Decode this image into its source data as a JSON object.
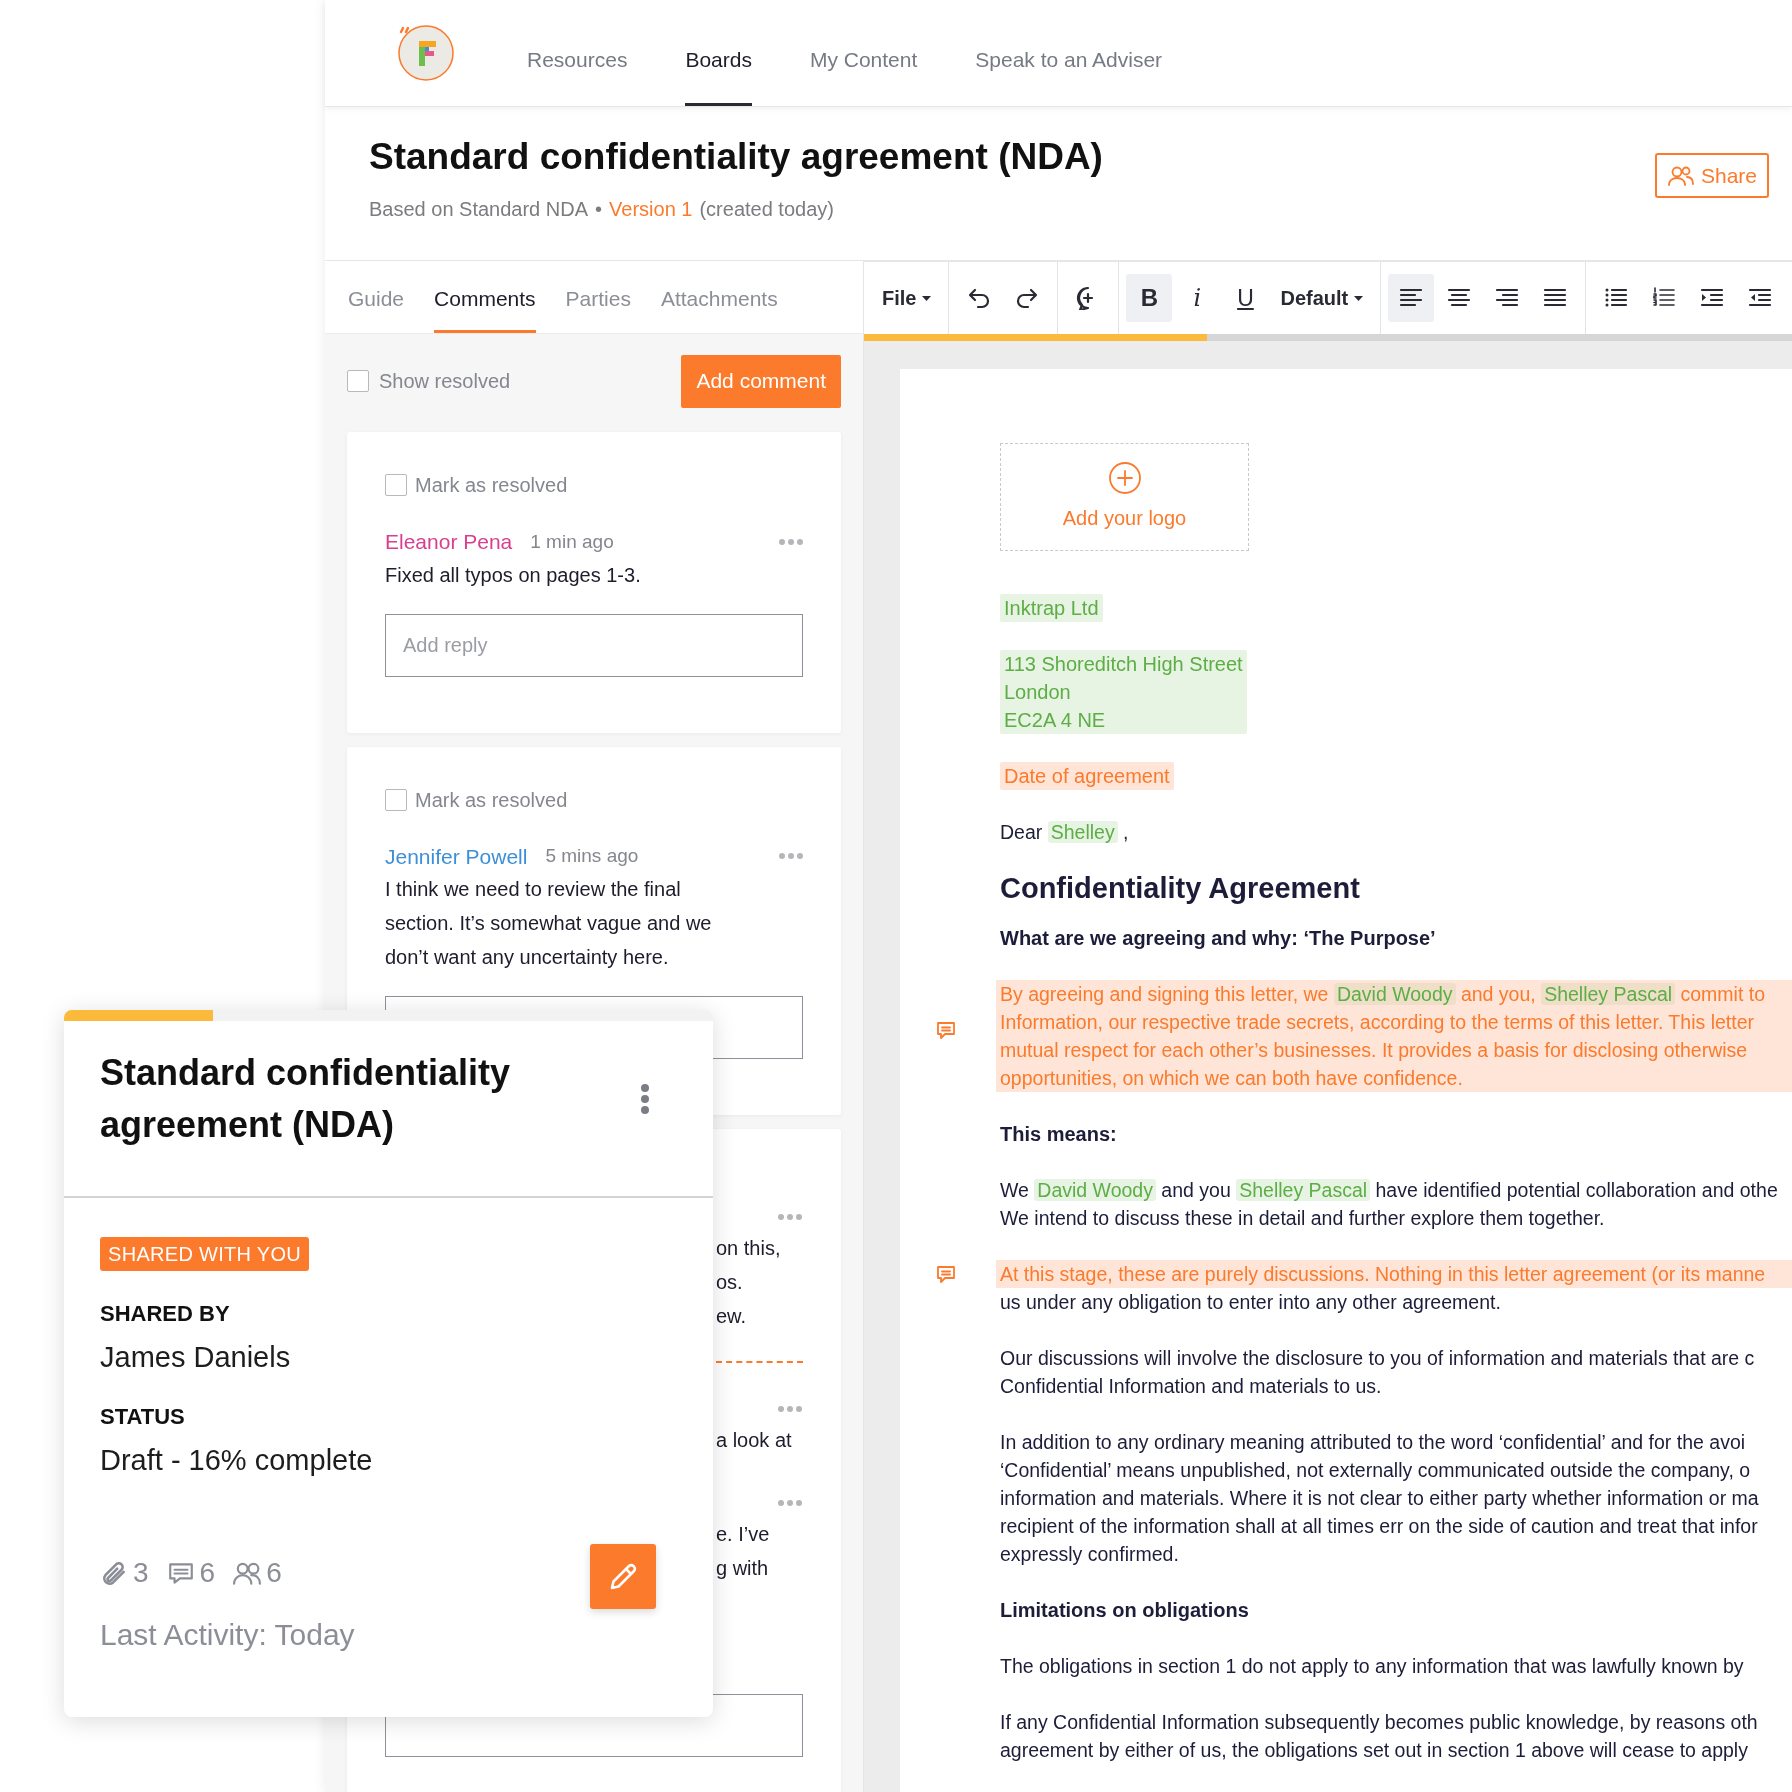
{
  "nav": {
    "items": [
      {
        "label": "Resources",
        "selected": false
      },
      {
        "label": "Boards",
        "selected": true
      },
      {
        "label": "My Content",
        "selected": false
      },
      {
        "label": "Speak to an Adviser",
        "selected": false
      }
    ]
  },
  "header": {
    "title": "Standard confidentiality agreement (NDA)",
    "based_on": "Based on Standard NDA",
    "separator": "•",
    "version": "Version 1",
    "created": "(created today)",
    "share": "Share"
  },
  "panel_tabs": [
    {
      "label": "Guide",
      "selected": false
    },
    {
      "label": "Comments",
      "selected": true
    },
    {
      "label": "Parties",
      "selected": false
    },
    {
      "label": "Attachments",
      "selected": false
    }
  ],
  "comments_panel": {
    "show_resolved": {
      "label": "Show resolved",
      "checked": false
    },
    "add_button": "Add comment",
    "comments": [
      {
        "kind": "full",
        "resolve": {
          "label": "Mark as resolved",
          "checked": false
        },
        "author": "Eleanor Pena",
        "color": "#d8408f",
        "time": "1 min ago",
        "text": "Fixed all typos on pages 1-3.",
        "reply_placeholder": "Add reply"
      },
      {
        "kind": "full",
        "resolve": {
          "label": "Mark as resolved",
          "checked": false
        },
        "author": "Jennifer Powell",
        "color": "#3d8fd8",
        "time": "5 mins ago",
        "text": "I think we need to review the final section. It’s somewhat vague and we don’t want any uncertainty here."
      },
      {
        "kind": "partial",
        "fragments": [
          [
            "on this,",
            "os.",
            "ew."
          ],
          [
            "a look at"
          ],
          [
            "e. I’ve",
            "g with"
          ]
        ]
      }
    ]
  },
  "toolbar": {
    "groups": [
      [
        {
          "kind": "menu",
          "label": "File"
        }
      ],
      [
        {
          "kind": "undo",
          "selected": false
        },
        {
          "kind": "redo",
          "selected": false
        }
      ],
      [
        {
          "kind": "comment",
          "selected": false
        }
      ],
      [
        {
          "kind": "bold",
          "label": "B",
          "selected": true
        },
        {
          "kind": "italic",
          "label": "i",
          "selected": false
        },
        {
          "kind": "underline",
          "label": "U",
          "selected": false
        },
        {
          "kind": "menu",
          "label": "Default"
        }
      ],
      [
        {
          "kind": "alignleft",
          "selected": true
        },
        {
          "kind": "aligncenter",
          "selected": false
        },
        {
          "kind": "alignright",
          "selected": false
        },
        {
          "kind": "justify",
          "selected": false
        }
      ],
      [
        {
          "kind": "bullets",
          "selected": false
        },
        {
          "kind": "numbers",
          "selected": false
        },
        {
          "kind": "indent",
          "selected": false
        },
        {
          "kind": "outdent",
          "selected": false
        }
      ]
    ],
    "progress": {
      "level": 0.37
    }
  },
  "document": {
    "blocks": [
      {
        "kind": "logo",
        "label": "Add your logo"
      },
      {
        "kind": "filled_field",
        "lines": [
          "Inktrap Ltd"
        ]
      },
      {
        "kind": "filled_field",
        "lines": [
          "113 Shoreditch High Street",
          "London",
          "EC2A 4 NE"
        ]
      },
      {
        "kind": "empty_field",
        "lines": [
          "Date of agreement"
        ]
      },
      {
        "kind": "text",
        "commented": false,
        "lines": [
          [
            {
              "text": "Dear "
            },
            {
              "text": "Shelley",
              "kind": "filled_field"
            },
            {
              "text": " ,"
            }
          ]
        ]
      },
      {
        "kind": "heading",
        "text": "Confidentiality Agreement"
      },
      {
        "kind": "subheading",
        "text": "What are we agreeing and why: ‘The Purpose’"
      },
      {
        "kind": "text",
        "commented": true,
        "lines": [
          [
            {
              "text": "By agreeing and signing this letter, we "
            },
            {
              "text": "David Woody",
              "kind": "filled_field"
            },
            {
              "text": " and you, "
            },
            {
              "text": "Shelley Pascal",
              "kind": "filled_field"
            },
            {
              "text": " commit to"
            }
          ],
          [
            {
              "text": "Information, our respective trade secrets, according to the terms of this letter.  This letter"
            }
          ],
          [
            {
              "text": "mutual respect for each other’s businesses. It provides a basis for disclosing otherwise"
            }
          ],
          [
            {
              "text": "opportunities, on which we can both have confidence."
            }
          ]
        ]
      },
      {
        "kind": "subheading",
        "text": "This means:"
      },
      {
        "kind": "text",
        "commented": false,
        "lines": [
          [
            {
              "text": "We "
            },
            {
              "text": "David Woody",
              "kind": "filled_field"
            },
            {
              "text": " and you "
            },
            {
              "text": "Shelley Pascal",
              "kind": "filled_field"
            },
            {
              "text": " have identified potential collaboration and othe"
            }
          ],
          [
            {
              "text": "We intend to discuss these in detail and further explore them together."
            }
          ]
        ]
      },
      {
        "kind": "text",
        "commented": true,
        "partial": true,
        "lines": [
          [
            {
              "text": "At this stage, these are purely discussions. Nothing in this letter agreement (or its manne"
            }
          ],
          [
            {
              "text": "us under any obligation to enter into any other agreement."
            }
          ]
        ]
      },
      {
        "kind": "text",
        "commented": false,
        "lines": [
          [
            {
              "text": "Our discussions will involve the disclosure to you of information and materials that are c"
            }
          ],
          [
            {
              "text": "Confidential Information and materials to us."
            }
          ]
        ]
      },
      {
        "kind": "text",
        "commented": false,
        "lines": [
          [
            {
              "text": "In addition to any ordinary meaning attributed to the word ‘confidential’ and for the avoi"
            }
          ],
          [
            {
              "text": "‘Confidential’ means unpublished, not externally communicated outside the company, o"
            }
          ],
          [
            {
              "text": "information and materials. Where it is not clear to either party whether information or ma"
            }
          ],
          [
            {
              "text": "recipient of the information shall at all times err on the side of caution and treat that infor"
            }
          ],
          [
            {
              "text": "expressly confirmed."
            }
          ]
        ]
      },
      {
        "kind": "subheading",
        "text": "Limitations on obligations"
      },
      {
        "kind": "text",
        "commented": false,
        "lines": [
          [
            {
              "text": "The obligations in section 1 do not apply to any information that was lawfully known by"
            }
          ]
        ]
      },
      {
        "kind": "text",
        "commented": false,
        "lines": [
          [
            {
              "text": "If any Confidential Information subsequently becomes public knowledge, by reasons oth"
            }
          ],
          [
            {
              "text": "agreement by either of us, the obligations set out in section 1 above will cease to apply"
            }
          ]
        ]
      }
    ]
  },
  "board_card": {
    "level": 0.23,
    "title": "Standard confidentiality agreement (NDA)",
    "badge": "SHARED WITH YOU",
    "shared_by_label": "SHARED BY",
    "shared_by": "James Daniels",
    "status_label": "STATUS",
    "status": "Draft - 16% complete",
    "counts": [
      {
        "kind": "attachments",
        "count": "3"
      },
      {
        "kind": "comments",
        "count": "6"
      },
      {
        "kind": "people",
        "count": "6"
      }
    ],
    "last_activity": "Last Activity: Today"
  }
}
